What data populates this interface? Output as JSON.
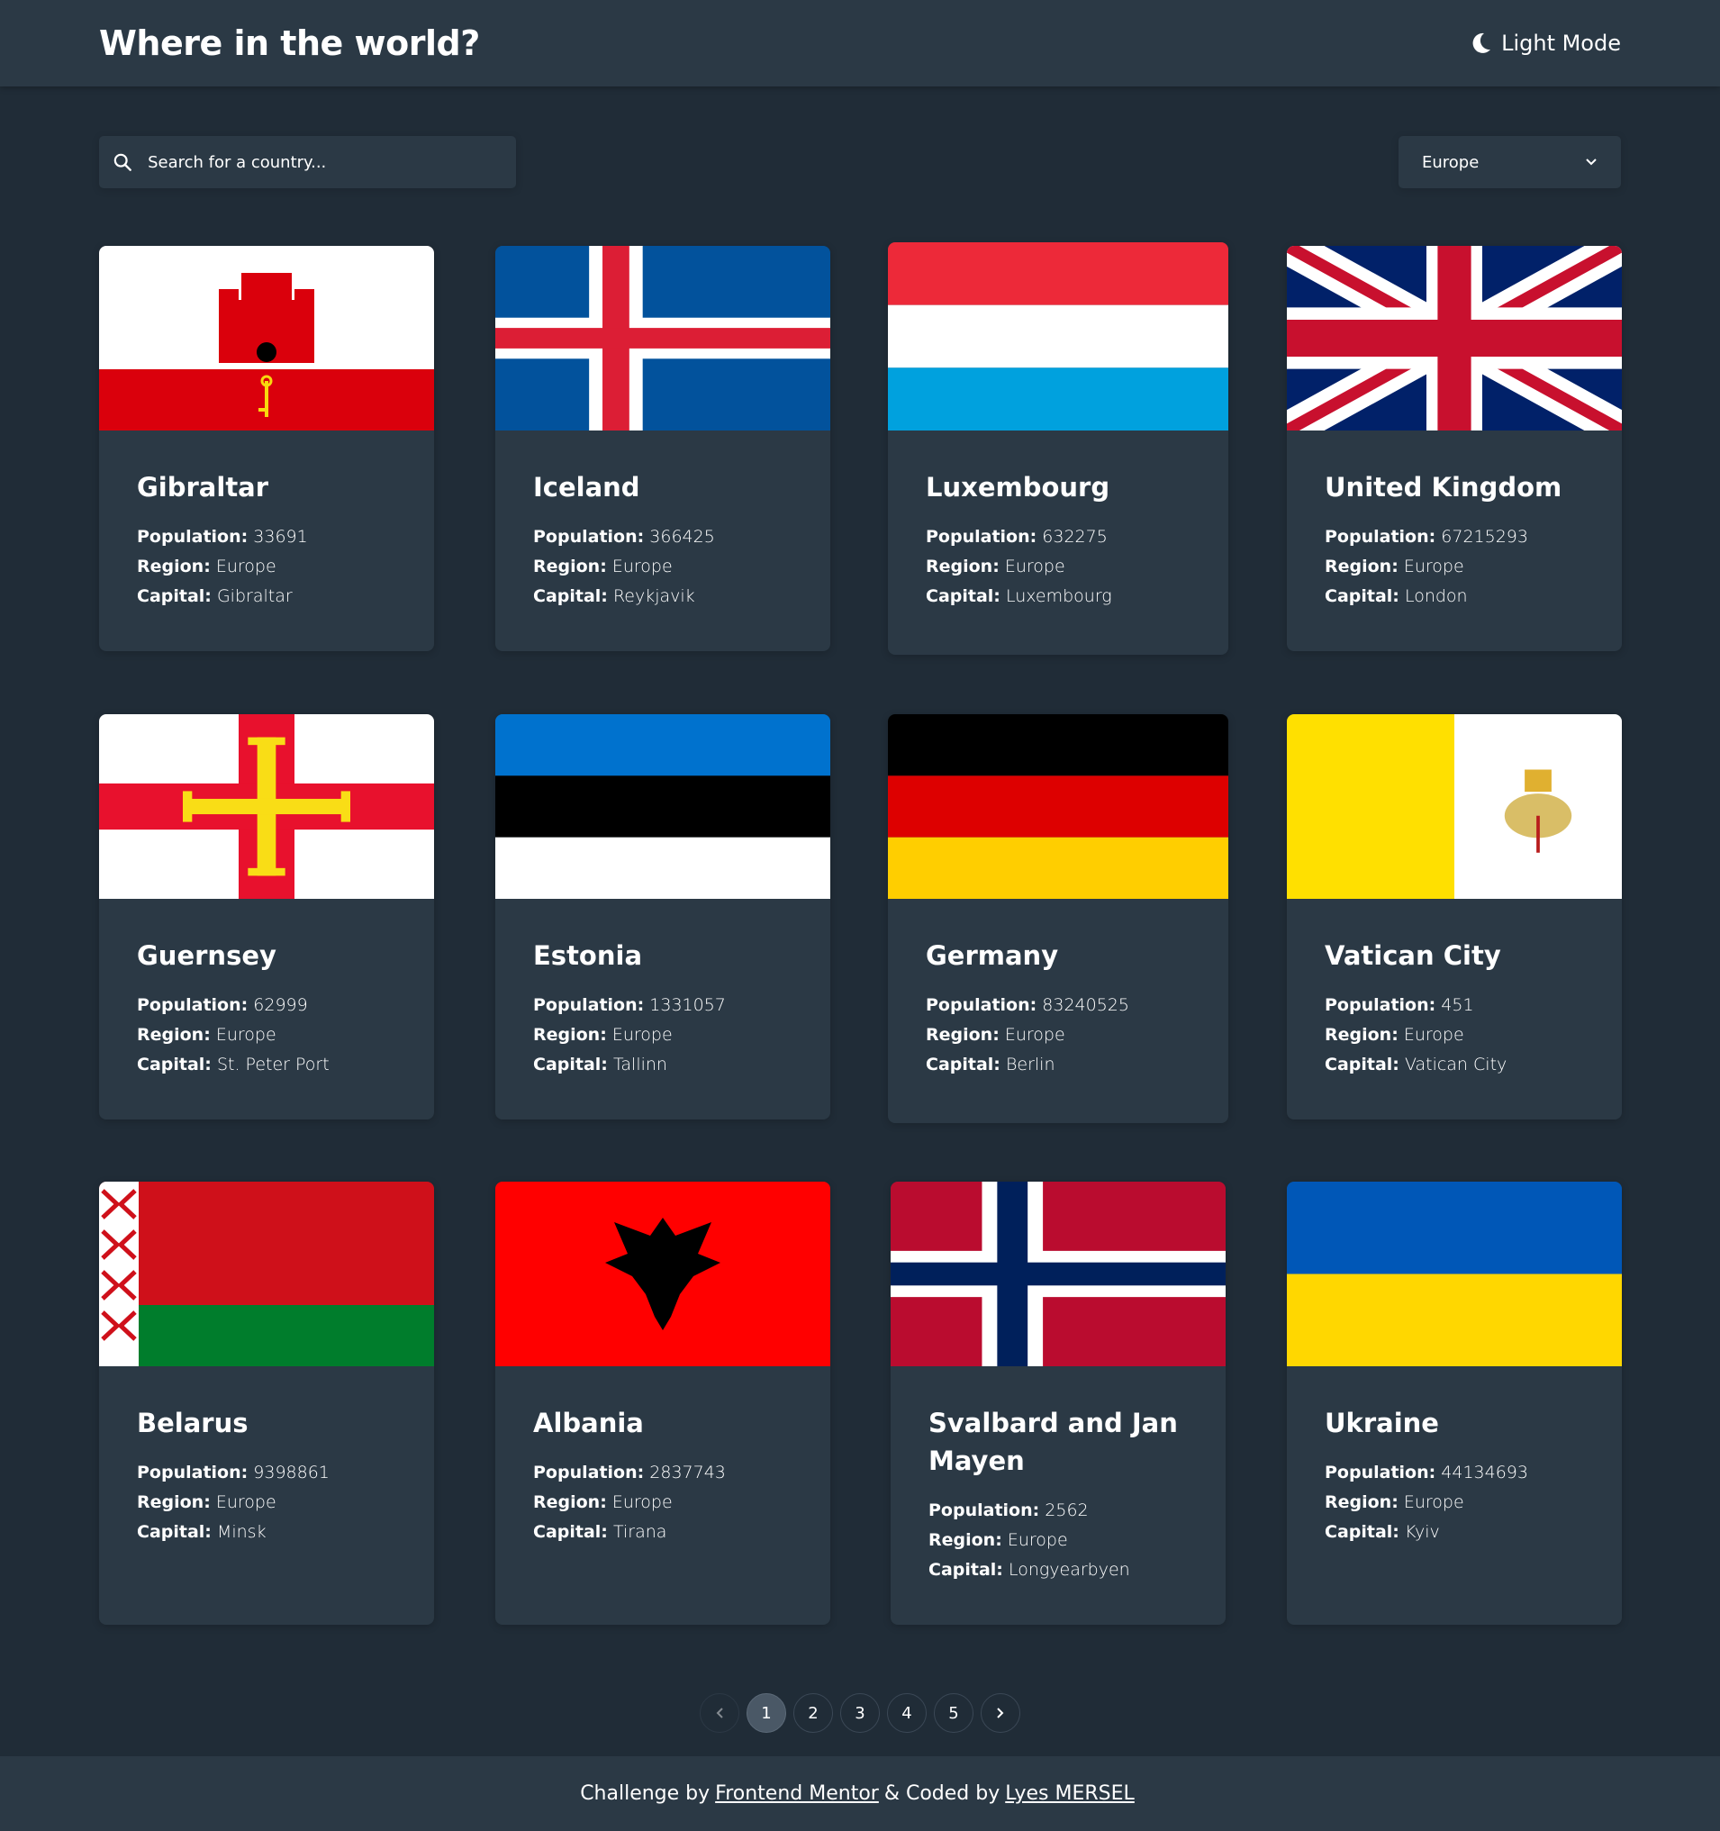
{
  "header": {
    "title": "Where in the world?",
    "mode_label": "Light Mode"
  },
  "search": {
    "placeholder": "Search for a country..."
  },
  "filter": {
    "selected": "Europe"
  },
  "labels": {
    "population": "Population:",
    "region": "Region:",
    "capital": "Capital:"
  },
  "countries": [
    {
      "name": "Gibraltar",
      "population": "33691",
      "region": "Europe",
      "capital": "Gibraltar"
    },
    {
      "name": "Iceland",
      "population": "366425",
      "region": "Europe",
      "capital": "Reykjavik"
    },
    {
      "name": "Luxembourg",
      "population": "632275",
      "region": "Europe",
      "capital": "Luxembourg"
    },
    {
      "name": "United Kingdom",
      "population": "67215293",
      "region": "Europe",
      "capital": "London"
    },
    {
      "name": "Guernsey",
      "population": "62999",
      "region": "Europe",
      "capital": "St. Peter Port"
    },
    {
      "name": "Estonia",
      "population": "1331057",
      "region": "Europe",
      "capital": "Tallinn"
    },
    {
      "name": "Germany",
      "population": "83240525",
      "region": "Europe",
      "capital": "Berlin"
    },
    {
      "name": "Vatican City",
      "population": "451",
      "region": "Europe",
      "capital": "Vatican City"
    },
    {
      "name": "Belarus",
      "population": "9398861",
      "region": "Europe",
      "capital": "Minsk"
    },
    {
      "name": "Albania",
      "population": "2837743",
      "region": "Europe",
      "capital": "Tirana"
    },
    {
      "name": "Svalbard and Jan Mayen",
      "population": "2562",
      "region": "Europe",
      "capital": "Longyearbyen"
    },
    {
      "name": "Ukraine",
      "population": "44134693",
      "region": "Europe",
      "capital": "Kyiv"
    }
  ],
  "pagination": {
    "pages": [
      "1",
      "2",
      "3",
      "4",
      "5"
    ],
    "current": "1"
  },
  "footer": {
    "prefix": "Challenge by",
    "link1": "Frontend Mentor",
    "middle": "& Coded by",
    "link2": "Lyes MERSEL"
  },
  "colors": {
    "background": "#202c37",
    "elements": "#2b3945",
    "text": "#ffffff"
  }
}
